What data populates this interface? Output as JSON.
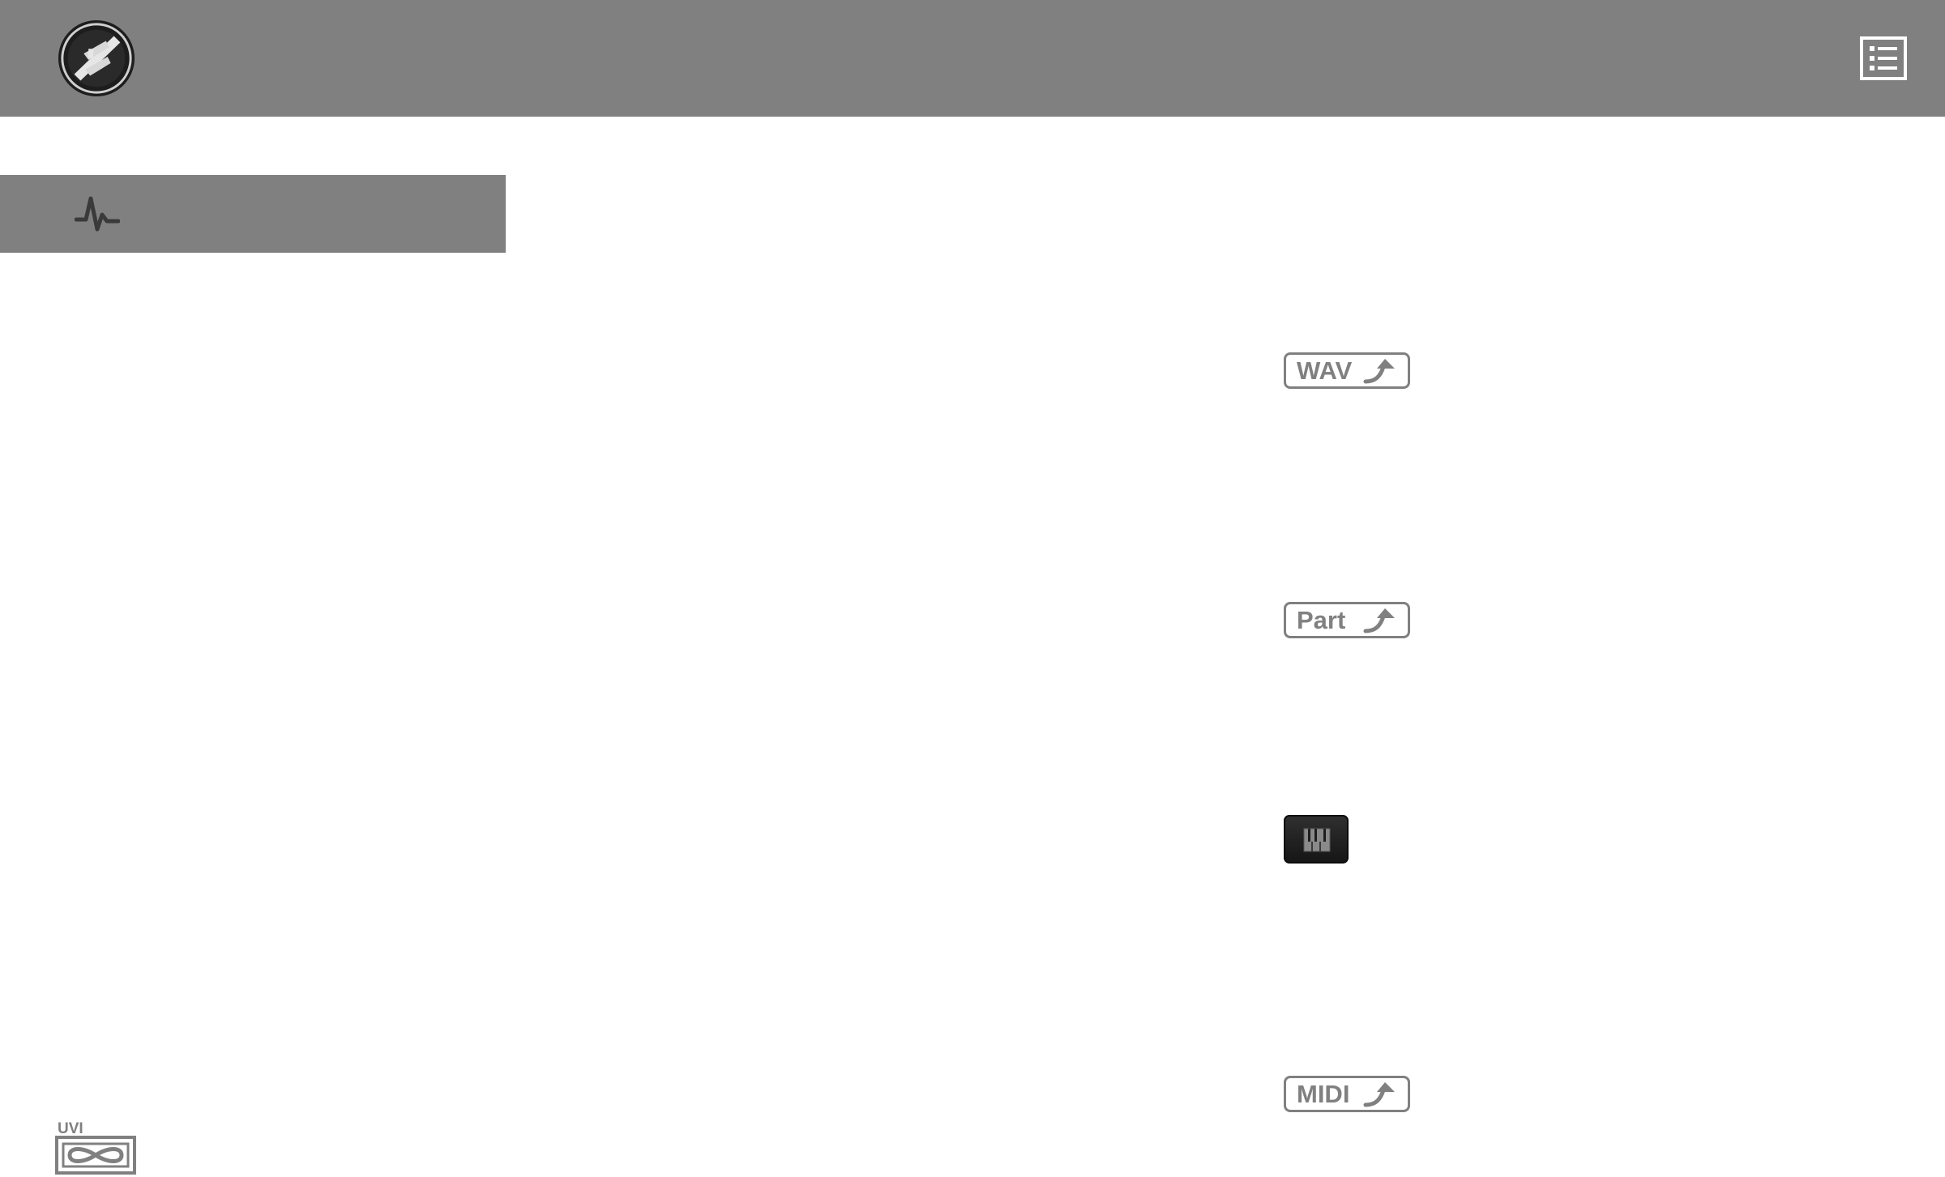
{
  "header": {
    "logo_icon": "circular-brand-logo-icon",
    "menu_icon": "list-menu-icon",
    "color": "#808080"
  },
  "section": {
    "icon": "waveform-icon"
  },
  "badges": {
    "wav": {
      "label": "WAV",
      "icon": "export-arrow-icon"
    },
    "part": {
      "label": "Part",
      "icon": "export-arrow-icon"
    },
    "midi": {
      "label": "MIDI",
      "icon": "export-arrow-icon"
    }
  },
  "keyboard_button": {
    "icon": "piano-keys-icon"
  },
  "brand": {
    "text": "UVI",
    "icon": "uvi-infinity-logo-icon"
  },
  "colors": {
    "gray": "#808080",
    "dark_button": "#1e1e1e",
    "background": "#ffffff"
  }
}
